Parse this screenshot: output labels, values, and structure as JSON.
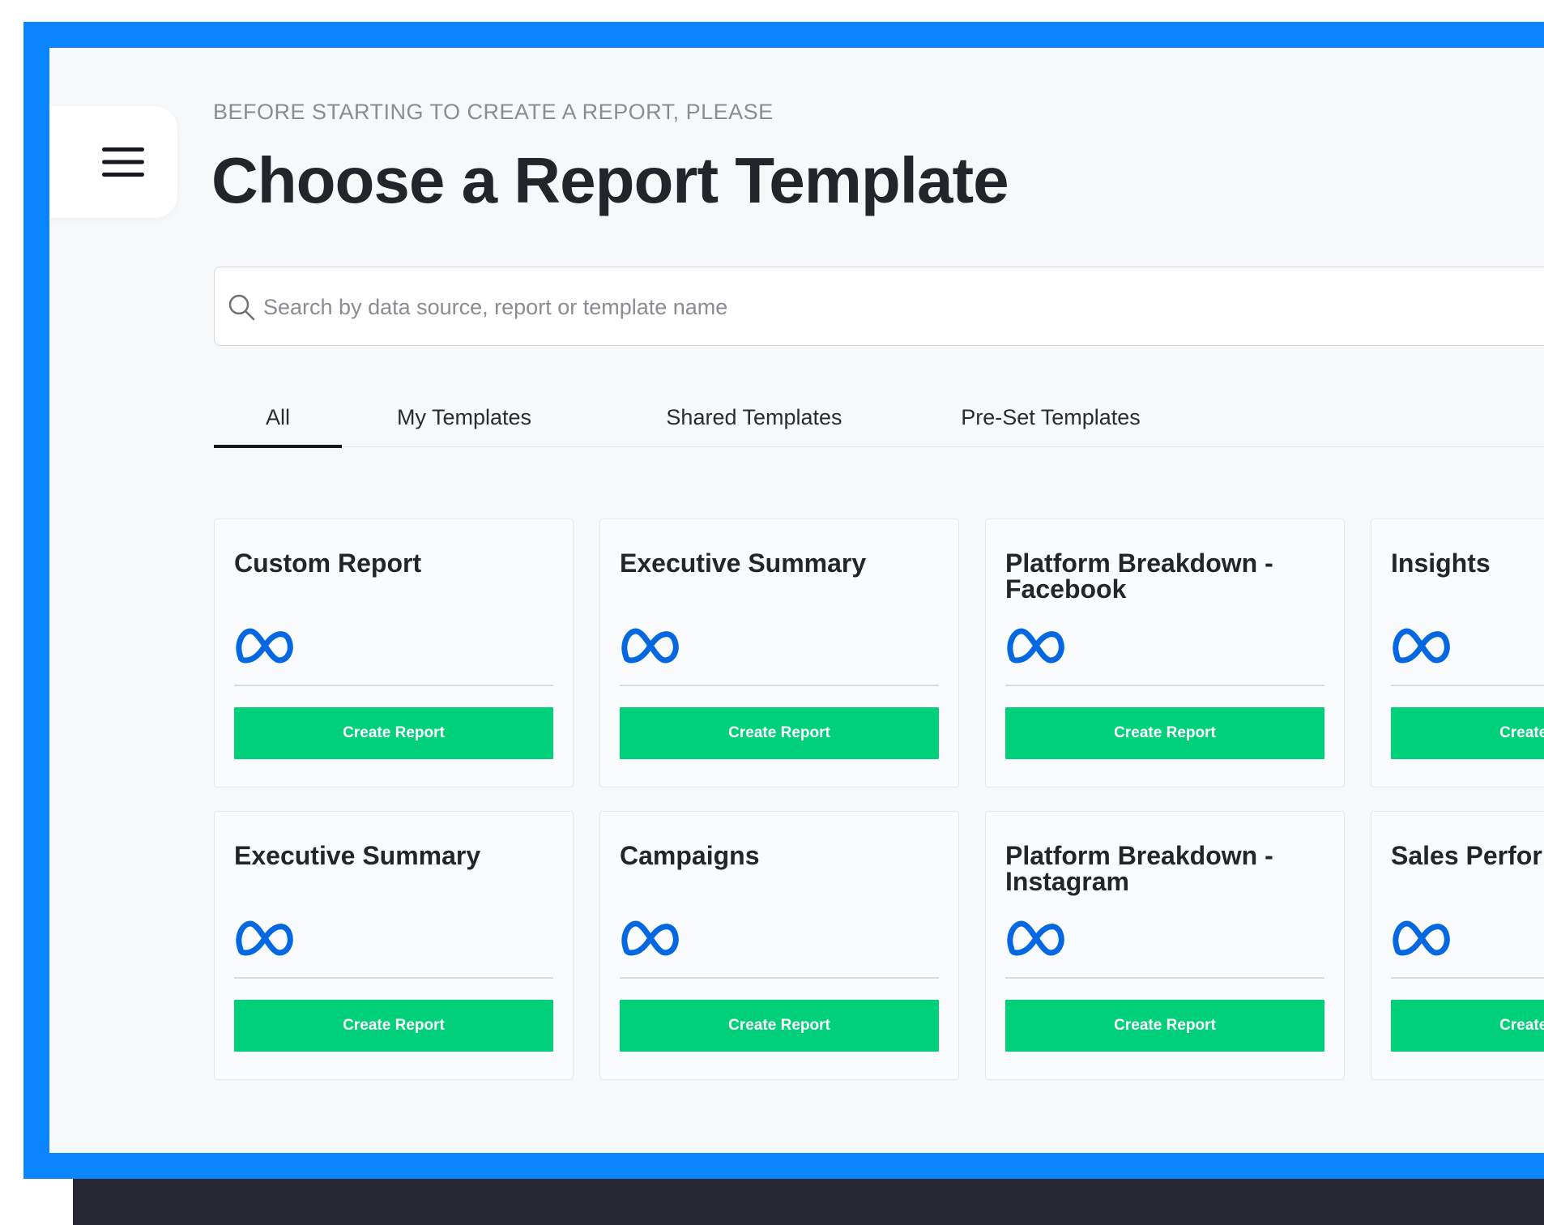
{
  "header": {
    "eyebrow": "BEFORE STARTING TO CREATE A REPORT, PLEASE",
    "title": "Choose a Report Template"
  },
  "menu": {
    "icon": "hamburger-menu-icon"
  },
  "search": {
    "placeholder": "Search by data source, report or template name",
    "value": "",
    "icon": "search-icon"
  },
  "tabs": [
    {
      "label": "All",
      "active": true
    },
    {
      "label": "My Templates",
      "active": false
    },
    {
      "label": "Shared Templates",
      "active": false
    },
    {
      "label": "Pre-Set Templates",
      "active": false
    }
  ],
  "cards": [
    {
      "title": "Custom Report",
      "icon": "meta-logo-icon",
      "button_label": "Create Report"
    },
    {
      "title": "Executive Summary",
      "icon": "meta-logo-icon",
      "button_label": "Create Report"
    },
    {
      "title": "Platform Breakdown - Facebook",
      "icon": "meta-logo-icon",
      "button_label": "Create Report"
    },
    {
      "title": "Insights",
      "icon": "meta-logo-icon",
      "button_label": "Create Report"
    },
    {
      "title": "Executive Summary",
      "icon": "meta-logo-icon",
      "button_label": "Create Report"
    },
    {
      "title": "Campaigns",
      "icon": "meta-logo-icon",
      "button_label": "Create Report"
    },
    {
      "title": "Platform Breakdown - Instagram",
      "icon": "meta-logo-icon",
      "button_label": "Create Report"
    },
    {
      "title": "Sales Performance",
      "icon": "meta-logo-icon",
      "button_label": "Create Report"
    }
  ],
  "colors": {
    "frame": "#0a84ff",
    "button": "#00d07a",
    "meta_blue": "#0668e1",
    "title": "#23252b"
  }
}
